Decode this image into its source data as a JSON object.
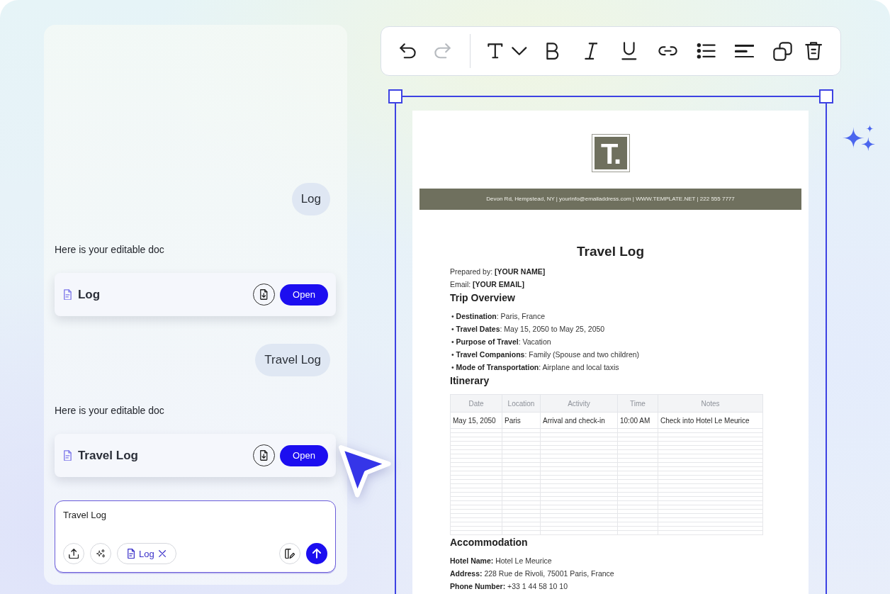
{
  "chat": {
    "messages": [
      {
        "kind": "user",
        "text": "Log"
      },
      {
        "kind": "assistant",
        "text": "Here is your editable doc"
      },
      {
        "kind": "document",
        "title": "Log",
        "action": "Open"
      },
      {
        "kind": "user",
        "text": "Travel Log"
      },
      {
        "kind": "assistant",
        "text": "Here is your editable doc"
      },
      {
        "kind": "document",
        "title": "Travel Log",
        "action": "Open"
      }
    ]
  },
  "composer": {
    "value": "Travel Log",
    "attachments": [
      {
        "label": "Log"
      }
    ]
  },
  "toolbar": {
    "history": [
      {
        "kind": "undo",
        "disabled": false
      },
      {
        "kind": "redo",
        "disabled": true
      }
    ],
    "format": [
      {
        "kind": "text",
        "disabled": false
      },
      {
        "kind": "dropdown",
        "disabled": false
      },
      {
        "kind": "bold",
        "disabled": false
      },
      {
        "kind": "italic",
        "disabled": false
      },
      {
        "kind": "underline",
        "disabled": false
      },
      {
        "kind": "link",
        "disabled": false
      },
      {
        "kind": "bullet_list",
        "disabled": false
      },
      {
        "kind": "align_left",
        "disabled": false
      },
      {
        "kind": "duplicate",
        "disabled": false
      },
      {
        "kind": "delete",
        "disabled": false
      }
    ]
  },
  "document": {
    "logo": "T.",
    "contact_bar": "Devon Rd, Hempstead, NY | yourinfo@emailaddress.com | WWW.TEMPLATE.NET | 222 555 7777",
    "title": "Travel Log",
    "meta": [
      "Prepared by: **[YOUR NAME]**",
      "Email: **[YOUR EMAIL]**"
    ],
    "sections": [
      {
        "heading": "Trip Overview",
        "kind": "bullets",
        "items": [
          "• **Destination**: Paris, France",
          "• **Travel Dates**: May 15, 2050 to May 25, 2050",
          "• **Purpose of Travel**: Vacation",
          "• **Travel Companions**: Family (Spouse and two children)",
          "• **Mode of Transportation**: Airplane and local taxis"
        ]
      },
      {
        "heading": "Itinerary",
        "kind": "table",
        "columns": [
          "Date",
          "Location",
          "Activity",
          "Time",
          "Notes"
        ],
        "rows": [
          [
            "May 15, 2050",
            "Paris",
            "Arrival and check-in",
            "10:00 AM",
            "Check into Hotel Le Meurice"
          ]
        ]
      },
      {
        "heading": "Accommodation",
        "kind": "fields",
        "items": [
          "**Hotel Name:** Hotel Le Meurice",
          "**Address:** 228 Rue de Rivoli, 75001 Paris, France",
          "**Phone Number:** +33 1 44 58 10 10"
        ]
      }
    ]
  }
}
